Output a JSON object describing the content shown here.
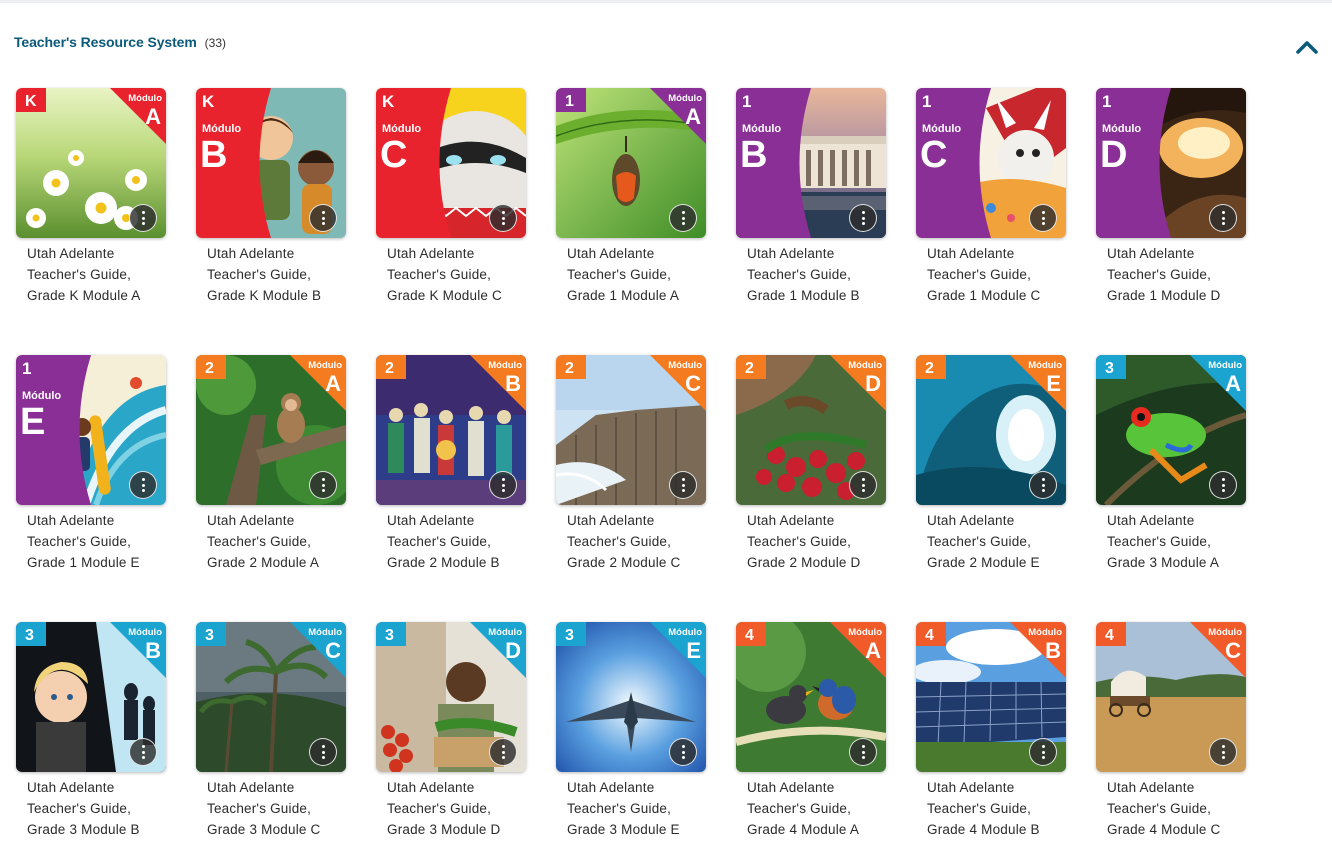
{
  "section": {
    "title": "Teacher's Resource System",
    "count": "(33)",
    "collapse_icon": "chevron-up-icon",
    "accent": "#0b5a7a"
  },
  "cards": [
    {
      "grade": "K",
      "module": "A",
      "word": "Módulo",
      "color": "#e8232e",
      "layout": "corner",
      "line1": "Utah Adelante",
      "line2": "Teacher's Guide,",
      "line3": "Grade K Module A",
      "scene": "daisies"
    },
    {
      "grade": "K",
      "module": "B",
      "word": "Módulo",
      "color": "#e8232e",
      "layout": "side",
      "line1": "Utah Adelante",
      "line2": "Teacher's Guide,",
      "line3": "Grade K Module B",
      "scene": "cartoon-kids"
    },
    {
      "grade": "K",
      "module": "C",
      "word": "Módulo",
      "color": "#e8232e",
      "layout": "side",
      "line1": "Utah Adelante",
      "line2": "Teacher's Guide,",
      "line3": "Grade K Module C",
      "scene": "cat-mask"
    },
    {
      "grade": "1",
      "module": "A",
      "word": "Módulo",
      "color": "#8a2f96",
      "layout": "corner",
      "line1": "Utah Adelante",
      "line2": "Teacher's Guide,",
      "line3": "Grade 1 Module A",
      "scene": "chrysalis"
    },
    {
      "grade": "1",
      "module": "B",
      "word": "Módulo",
      "color": "#8a2f96",
      "layout": "side",
      "line1": "Utah Adelante",
      "line2": "Teacher's Guide,",
      "line3": "Grade 1 Module B",
      "scene": "memorial"
    },
    {
      "grade": "1",
      "module": "C",
      "word": "Módulo",
      "color": "#8a2f96",
      "layout": "side",
      "line1": "Utah Adelante",
      "line2": "Teacher's Guide,",
      "line3": "Grade 1 Module C",
      "scene": "cartoon-fox"
    },
    {
      "grade": "1",
      "module": "D",
      "word": "Módulo",
      "color": "#8a2f96",
      "layout": "side",
      "line1": "Utah Adelante",
      "line2": "Teacher's Guide,",
      "line3": "Grade 1 Module D",
      "scene": "cave"
    },
    {
      "grade": "1",
      "module": "E",
      "word": "Módulo",
      "color": "#8a2f96",
      "layout": "side",
      "line1": "Utah Adelante",
      "line2": "Teacher's Guide,",
      "line3": "Grade 1 Module E",
      "scene": "surfer"
    },
    {
      "grade": "2",
      "module": "A",
      "word": "Módulo",
      "color": "#f47b20",
      "layout": "corner",
      "line1": "Utah Adelante",
      "line2": "Teacher's Guide,",
      "line3": "Grade 2 Module A",
      "scene": "monkey"
    },
    {
      "grade": "2",
      "module": "B",
      "word": "Módulo",
      "color": "#f47b20",
      "layout": "corner",
      "line1": "Utah Adelante",
      "line2": "Teacher's Guide,",
      "line3": "Grade 2 Module B",
      "scene": "crowd"
    },
    {
      "grade": "2",
      "module": "C",
      "word": "Módulo",
      "color": "#f47b20",
      "layout": "corner",
      "line1": "Utah Adelante",
      "line2": "Teacher's Guide,",
      "line3": "Grade 2 Module C",
      "scene": "rocks"
    },
    {
      "grade": "2",
      "module": "D",
      "word": "Módulo",
      "color": "#f47b20",
      "layout": "corner",
      "line1": "Utah Adelante",
      "line2": "Teacher's Guide,",
      "line3": "Grade 2 Module D",
      "scene": "radishes"
    },
    {
      "grade": "2",
      "module": "E",
      "word": "Módulo",
      "color": "#f47b20",
      "layout": "corner",
      "line1": "Utah Adelante",
      "line2": "Teacher's Guide,",
      "line3": "Grade 2 Module E",
      "scene": "ice-cave"
    },
    {
      "grade": "3",
      "module": "A",
      "word": "Módulo",
      "color": "#1aa4cf",
      "layout": "corner",
      "line1": "Utah Adelante",
      "line2": "Teacher's Guide,",
      "line3": "Grade 3 Module A",
      "scene": "frog"
    },
    {
      "grade": "3",
      "module": "B",
      "word": "Módulo",
      "color": "#1aa4cf",
      "layout": "corner",
      "line1": "Utah Adelante",
      "line2": "Teacher's Guide,",
      "line3": "Grade 3 Module B",
      "scene": "girl-shadows"
    },
    {
      "grade": "3",
      "module": "C",
      "word": "Módulo",
      "color": "#1aa4cf",
      "layout": "corner",
      "line1": "Utah Adelante",
      "line2": "Teacher's Guide,",
      "line3": "Grade 3 Module C",
      "scene": "palms"
    },
    {
      "grade": "3",
      "module": "D",
      "word": "Módulo",
      "color": "#1aa4cf",
      "layout": "corner",
      "line1": "Utah Adelante",
      "line2": "Teacher's Guide,",
      "line3": "Grade 3 Module D",
      "scene": "market"
    },
    {
      "grade": "3",
      "module": "E",
      "word": "Módulo",
      "color": "#1aa4cf",
      "layout": "corner",
      "line1": "Utah Adelante",
      "line2": "Teacher's Guide,",
      "line3": "Grade 3 Module E",
      "scene": "jet"
    },
    {
      "grade": "4",
      "module": "A",
      "word": "Módulo",
      "color": "#f15a29",
      "layout": "corner",
      "line1": "Utah Adelante",
      "line2": "Teacher's Guide,",
      "line3": "Grade 4 Module A",
      "scene": "birds"
    },
    {
      "grade": "4",
      "module": "B",
      "word": "Módulo",
      "color": "#f15a29",
      "layout": "corner",
      "line1": "Utah Adelante",
      "line2": "Teacher's Guide,",
      "line3": "Grade 4 Module B",
      "scene": "solar"
    },
    {
      "grade": "4",
      "module": "C",
      "word": "Módulo",
      "color": "#f15a29",
      "layout": "corner",
      "line1": "Utah Adelante",
      "line2": "Teacher's Guide,",
      "line3": "Grade 4 Module C",
      "scene": "wagon"
    }
  ]
}
